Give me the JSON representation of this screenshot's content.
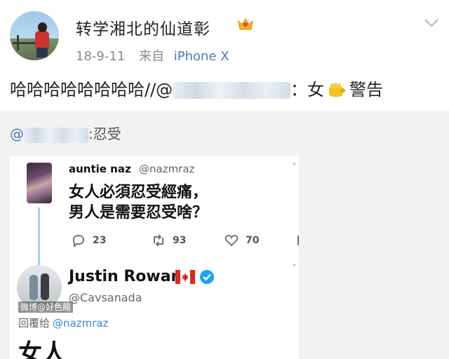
{
  "post": {
    "username": "转学湘北的仙道彰",
    "date": "18-9-11",
    "source_prefix": "来自",
    "device": "iPhone X",
    "repost_prefix": "哈哈哈哈哈哈哈哈//@",
    "repost_suffix": "：女",
    "repost_end": "警告"
  },
  "original": {
    "prefix": "@",
    "text": ":忍受"
  },
  "tweet1": {
    "name": "auntie naz",
    "handle": "@nazmraz",
    "line1": "女人必須忍受經痛，",
    "line2": "男人是需要忍受啥？",
    "replies": "23",
    "retweets": "93",
    "likes": "70"
  },
  "tweet2": {
    "name": "Justin Rowan",
    "handle": "@Cavsanada",
    "watermark": "微博@好色龍",
    "reply_label": "回覆给",
    "reply_mention": "@nazmraz",
    "body": "女人"
  },
  "colors": {
    "link": "#4a7ab8",
    "mention": "#3a8ad0",
    "grey_bg": "#f2f2f2",
    "thread": "#9fd3ea",
    "verified": "#1da1f2",
    "flag_red": "#d52b1e"
  },
  "icons": [
    "crown-icon",
    "chevron-down-icon",
    "fist-icon",
    "reply-icon",
    "retweet-icon",
    "like-icon",
    "message-icon",
    "canada-flag-icon",
    "verified-icon"
  ]
}
